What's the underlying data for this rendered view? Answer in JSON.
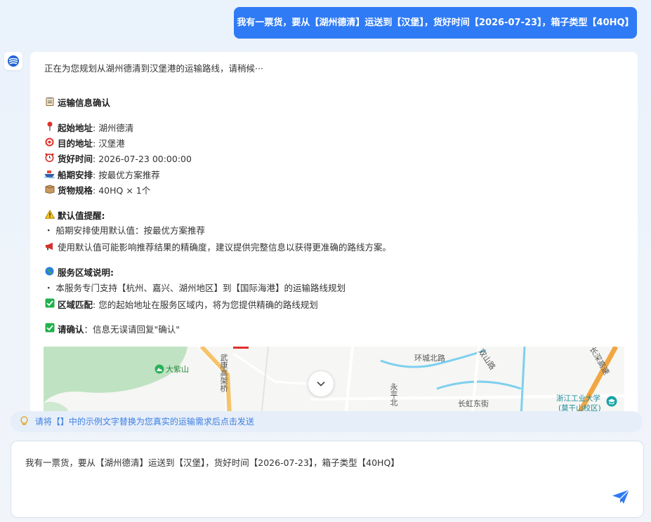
{
  "user_message": "我有一票货，要从【湖州德清】运送到【汉堡】，货好时间【2026-07-23】，箱子类型【40HQ】",
  "bot": {
    "intro": "正在为您规划从湖州德清到汉堡港的运输路线，请稍候···",
    "info_title": "运输信息确认",
    "fields": [
      {
        "label": "起始地址",
        "value": ": 湖州德清"
      },
      {
        "label": "目的地址",
        "value": ": 汉堡港"
      },
      {
        "label": "货好时间",
        "value": ": 2026-07-23 00:00:00"
      },
      {
        "label": "船期安排",
        "value": ": 按最优方案推荐"
      },
      {
        "label": "货物规格",
        "value": ": 40HQ × 1个"
      }
    ],
    "default_title": "默认值提醒",
    "default_colon": ":",
    "default_item": "・ 船期安排使用默认值：按最优方案推荐",
    "default_note": "使用默认值可能影响推荐结果的精确度，建议提供完整信息以获得更准确的路线方案。",
    "service_title": "服务区域说明",
    "service_colon": ":",
    "service_item": "・ 本服务专门支持【杭州、嘉兴、湖州地区】到【国际海港】的运输路线规划",
    "match_label": "区域匹配",
    "match_text": ": 您的起始地址在服务区域内，将为您提供精确的路线规划",
    "confirm_label": "请确认",
    "confirm_text": "：信息无误请回复\"确认\""
  },
  "map": {
    "labels": {
      "dazishan": "大紫山",
      "wukang": "武康高架桥",
      "huancheng": "环城北路",
      "shuangshan": "双山路",
      "yongping": "永平北",
      "changhong": "长虹东街",
      "zhegong": "浙江工业大学",
      "moganshan": "(莫干山校区)",
      "changjiang": "长深高速"
    }
  },
  "hint": "请将【】中的示例文字替换为您真实的运输需求后点击发送",
  "input_value": "我有一票货，要从【湖州德清】运送到【汉堡】，货好时间【2026-07-23】，箱子类型【40HQ】",
  "icons": {
    "clipboard": "clipboard-icon",
    "pin": "pushpin-icon",
    "target": "target-icon",
    "clock": "alarm-clock-icon",
    "ship": "ship-icon",
    "package": "package-icon",
    "warning": "warning-icon",
    "megaphone": "megaphone-icon",
    "globe": "globe-icon",
    "check": "check-icon",
    "bulb": "lightbulb-icon",
    "send": "send-icon",
    "chevron": "chevron-down-icon"
  },
  "colors": {
    "accent": "#2f7bf5",
    "hint_text": "#3d7fe0",
    "check_green": "#22b14c"
  }
}
